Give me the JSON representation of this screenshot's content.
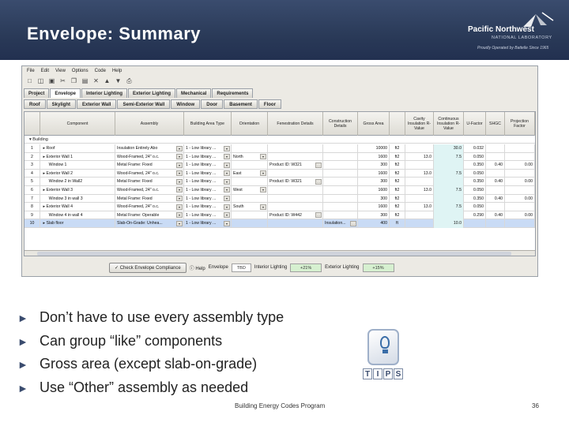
{
  "slide": {
    "title": "Envelope: Summary",
    "logo_name": "Pacific Northwest",
    "logo_sub": "NATIONAL LABORATORY",
    "logo_tag": "Proudly Operated by Battelle Since 1965",
    "footer": "Building Energy Codes Program",
    "page_number": "36",
    "tips_letters": [
      "T",
      "I",
      "P",
      "S"
    ]
  },
  "app": {
    "menu": [
      "File",
      "Edit",
      "View",
      "Options",
      "Code",
      "Help"
    ],
    "tabs": [
      "Project",
      "Envelope",
      "Interior Lighting",
      "Exterior Lighting",
      "Mechanical",
      "Requirements"
    ],
    "active_tab": 1,
    "subtabs": [
      "Roof",
      "Skylight",
      "Exterior Wall",
      "Semi-Exterior Wall",
      "Window",
      "Door",
      "Basement",
      "Floor"
    ],
    "columns": [
      "",
      "Component",
      "Assembly",
      "Building Area Type",
      "Orientation",
      "Fenestration Details",
      "Construction Details",
      "Gross Area",
      "",
      "Cavity Insulation R-Value",
      "Continuous Insulation R-Value",
      "U-Factor",
      "SHGC",
      "Projection Factor"
    ],
    "group_label": "Building",
    "rows": [
      {
        "n": "1",
        "component": "Roof",
        "assembly": "Insulation Entirely Abo",
        "area_type": "1 - Low library ...",
        "orientation": "",
        "fen": "",
        "constr": "",
        "gross": "10000",
        "unit": "ft2",
        "cavity": "",
        "cont": "30.0",
        "u": "0.032",
        "shgc": "",
        "proj": ""
      },
      {
        "n": "2",
        "component": "Exterior Wall 1",
        "assembly": "Wood-Framed, 24\" o.c.",
        "area_type": "1 - Low library ...",
        "orientation": "North",
        "fen": "",
        "constr": "",
        "gross": "1600",
        "unit": "ft2",
        "cavity": "13.0",
        "cont": "7.5",
        "u": "0.050",
        "shgc": "",
        "proj": ""
      },
      {
        "n": "3",
        "component": "Window 1",
        "assembly": "Metal Frame: Fixed",
        "area_type": "1 - Low library ...",
        "orientation": "",
        "fen": "Product ID: W321",
        "constr": "",
        "gross": "300",
        "unit": "ft2",
        "cavity": "",
        "cont": "",
        "u": "0.350",
        "shgc": "0.40",
        "proj": "0.00"
      },
      {
        "n": "4",
        "component": "Exterior Wall 2",
        "assembly": "Wood-Framed, 24\" o.c.",
        "area_type": "1 - Low library ...",
        "orientation": "East",
        "fen": "",
        "constr": "",
        "gross": "1600",
        "unit": "ft2",
        "cavity": "13.0",
        "cont": "7.5",
        "u": "0.050",
        "shgc": "",
        "proj": ""
      },
      {
        "n": "5",
        "component": "Window 2 in Wall2",
        "assembly": "Metal Frame: Fixed",
        "area_type": "1 - Low library ...",
        "orientation": "",
        "fen": "Product ID: W321",
        "constr": "",
        "gross": "300",
        "unit": "ft2",
        "cavity": "",
        "cont": "",
        "u": "0.350",
        "shgc": "0.40",
        "proj": "0.00"
      },
      {
        "n": "6",
        "component": "Exterior Wall 3",
        "assembly": "Wood-Framed, 24\" o.c.",
        "area_type": "1 - Low library ...",
        "orientation": "West",
        "fen": "",
        "constr": "",
        "gross": "1600",
        "unit": "ft2",
        "cavity": "13.0",
        "cont": "7.5",
        "u": "0.050",
        "shgc": "",
        "proj": ""
      },
      {
        "n": "7",
        "component": "Window 3 in wall 3",
        "assembly": "Metal Frame: Fixed",
        "area_type": "1 - Low library ...",
        "orientation": "",
        "fen": "",
        "constr": "",
        "gross": "300",
        "unit": "ft2",
        "cavity": "",
        "cont": "",
        "u": "0.350",
        "shgc": "0.40",
        "proj": "0.00"
      },
      {
        "n": "8",
        "component": "Exterior Wall 4",
        "assembly": "Wood-Framed, 24\" o.c.",
        "area_type": "1 - Low library ...",
        "orientation": "South",
        "fen": "",
        "constr": "",
        "gross": "1600",
        "unit": "ft2",
        "cavity": "13.0",
        "cont": "7.5",
        "u": "0.050",
        "shgc": "",
        "proj": ""
      },
      {
        "n": "9",
        "component": "Window 4 in wall 4",
        "assembly": "Metal Frame: Operable",
        "area_type": "1 - Low library ...",
        "orientation": "",
        "fen": "Product ID: W442",
        "constr": "",
        "gross": "300",
        "unit": "ft2",
        "cavity": "",
        "cont": "",
        "u": "0.290",
        "shgc": "0.40",
        "proj": "0.00"
      },
      {
        "n": "10",
        "component": "Slab floor",
        "assembly": "Slab-On-Grade: Unhea...",
        "area_type": "1 - Low library ...",
        "orientation": "",
        "fen": "",
        "constr": "Insulation...",
        "gross": "400",
        "unit": "ft",
        "cavity": "",
        "cont": "10.0",
        "u": "",
        "shgc": "",
        "proj": ""
      }
    ],
    "status": {
      "check_button": "Check Envelope Compliance",
      "help": "Help",
      "envelope_label": "Envelope",
      "envelope_value": "TBD",
      "interior_label": "Interior Lighting",
      "interior_value": "+21%",
      "exterior_label": "Exterior Lighting",
      "exterior_value": "+15%"
    }
  },
  "bullets": [
    "Don’t have to use every assembly type",
    "Can group “like” components",
    "Gross area (except slab-on-grade)",
    "Use “Other” assembly as needed"
  ]
}
